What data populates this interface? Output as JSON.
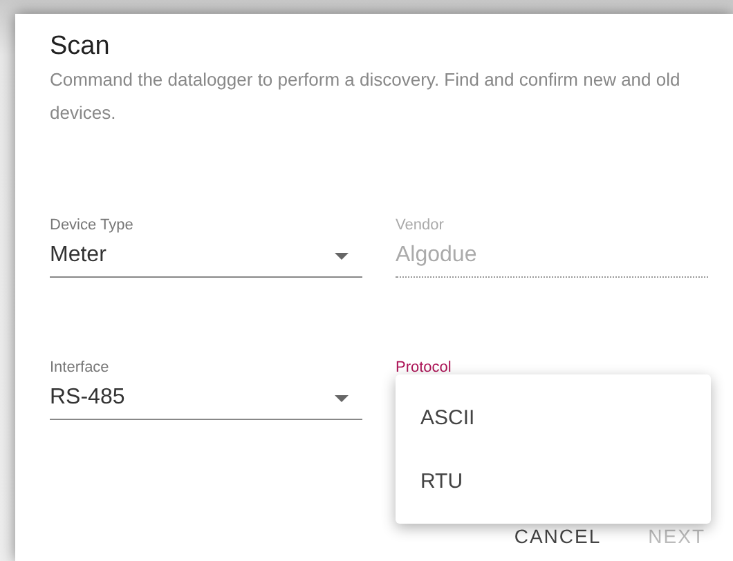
{
  "dialog": {
    "title": "Scan",
    "description": "Command the datalogger to perform a discovery. Find and confirm new and old devices."
  },
  "fields": [
    {
      "kind": "select",
      "label": "Device Type",
      "value": "Meter",
      "disabled": false,
      "focused": false
    },
    {
      "kind": "text",
      "label": "Vendor",
      "value": "Algodue",
      "disabled": true,
      "focused": false
    },
    {
      "kind": "select",
      "label": "Interface",
      "value": "RS-485",
      "disabled": false,
      "focused": false
    },
    {
      "label": "Protocol",
      "focused": true,
      "menu": [
        {
          "label": "ASCII",
          "selected": false
        },
        {
          "label": "RTU",
          "selected": false
        }
      ]
    }
  ],
  "buttons": [
    {
      "label": "CANCEL",
      "disabled": false
    },
    {
      "label": "NEXT",
      "disabled": true
    }
  ]
}
